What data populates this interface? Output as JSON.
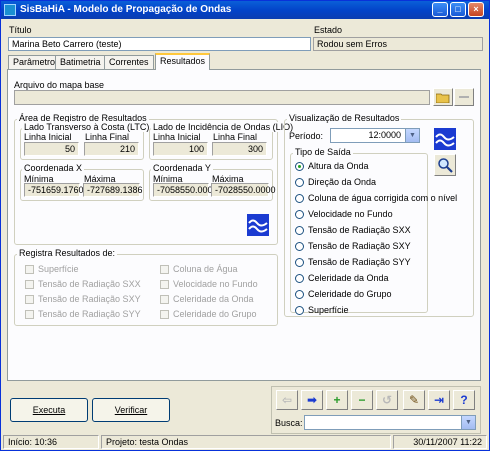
{
  "window": {
    "title": "SisBaHiA - Modelo de Propagação de Ondas"
  },
  "header": {
    "title_label": "Título",
    "title_value": "Marina Beto Carrero (teste)",
    "state_label": "Estado",
    "state_value": "Rodou sem Erros"
  },
  "tabs": [
    {
      "label": "Parâmetros"
    },
    {
      "label": "Batimetria"
    },
    {
      "label": "Correntes"
    },
    {
      "label": "Resultados"
    }
  ],
  "map": {
    "label": "Arquivo do mapa base",
    "value": ""
  },
  "area": {
    "title": "Área de Registro de Resultados",
    "ltc": {
      "title": "Lado Transverso à Costa (LTC)",
      "start_label": "Linha Inicial",
      "end_label": "Linha Final",
      "start": "50",
      "end": "210"
    },
    "lio": {
      "title": "Lado de Incidência de Ondas  (LIO)",
      "start_label": "Linha Inicial",
      "end_label": "Linha Final",
      "start": "100",
      "end": "300"
    },
    "coord_x": {
      "title": "Coordenada X",
      "min_label": "Mínima",
      "max_label": "Máxima",
      "min": "-751659.1760",
      "max": "-727689.1386"
    },
    "coord_y": {
      "title": "Coordenada Y",
      "min_label": "Mínima",
      "max_label": "Máxima",
      "min": "-7058550.0000",
      "max": "-7028550.0000"
    }
  },
  "register": {
    "title": "Registra Resultados de:",
    "left": [
      "Superfície",
      "Tensão de Radiação SXX",
      "Tensão de Radiação SXY",
      "Tensão de Radiação SYY"
    ],
    "right": [
      "Coluna de Água",
      "Velocidade no Fundo",
      "Celeridade da Onda",
      "Celeridade do Grupo"
    ]
  },
  "visual": {
    "title": "Visualização de Resultados",
    "period_label": "Período:",
    "period_value": "12:0000",
    "output_title": "Tipo de Saída",
    "options": [
      "Altura da Onda",
      "Direção da Onda",
      "Coluna de água corrigida com o nível",
      "Velocidade no Fundo",
      "Tensão de Radiação SXX",
      "Tensão de Radiação SXY",
      "Tensão de Radiação SYY",
      "Celeridade da Onda",
      "Celeridade do Grupo",
      "Superfície"
    ],
    "selected_index": 0
  },
  "buttons": {
    "execute": "Executa",
    "verify": "Verificar"
  },
  "nav": {
    "search_label": "Busca:",
    "search_value": ""
  },
  "status": {
    "start": "Início: 10:36",
    "project": "Projeto: testa Ondas",
    "datetime": "30/11/2007 11:22"
  },
  "colors": {
    "accent": "#0a3db0",
    "wave_icon": "#1b3bd1"
  }
}
